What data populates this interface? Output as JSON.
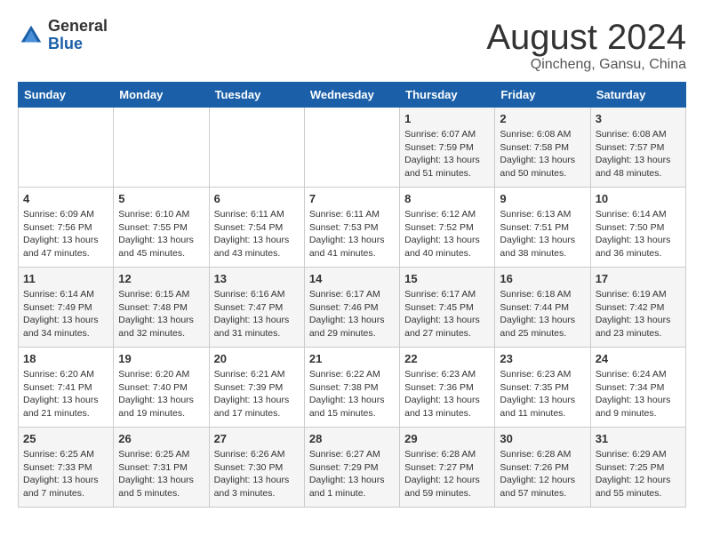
{
  "header": {
    "logo_general": "General",
    "logo_blue": "Blue",
    "month_title": "August 2024",
    "location": "Qincheng, Gansu, China"
  },
  "weekdays": [
    "Sunday",
    "Monday",
    "Tuesday",
    "Wednesday",
    "Thursday",
    "Friday",
    "Saturday"
  ],
  "weeks": [
    [
      {
        "day": "",
        "info": ""
      },
      {
        "day": "",
        "info": ""
      },
      {
        "day": "",
        "info": ""
      },
      {
        "day": "",
        "info": ""
      },
      {
        "day": "1",
        "info": "Sunrise: 6:07 AM\nSunset: 7:59 PM\nDaylight: 13 hours\nand 51 minutes."
      },
      {
        "day": "2",
        "info": "Sunrise: 6:08 AM\nSunset: 7:58 PM\nDaylight: 13 hours\nand 50 minutes."
      },
      {
        "day": "3",
        "info": "Sunrise: 6:08 AM\nSunset: 7:57 PM\nDaylight: 13 hours\nand 48 minutes."
      }
    ],
    [
      {
        "day": "4",
        "info": "Sunrise: 6:09 AM\nSunset: 7:56 PM\nDaylight: 13 hours\nand 47 minutes."
      },
      {
        "day": "5",
        "info": "Sunrise: 6:10 AM\nSunset: 7:55 PM\nDaylight: 13 hours\nand 45 minutes."
      },
      {
        "day": "6",
        "info": "Sunrise: 6:11 AM\nSunset: 7:54 PM\nDaylight: 13 hours\nand 43 minutes."
      },
      {
        "day": "7",
        "info": "Sunrise: 6:11 AM\nSunset: 7:53 PM\nDaylight: 13 hours\nand 41 minutes."
      },
      {
        "day": "8",
        "info": "Sunrise: 6:12 AM\nSunset: 7:52 PM\nDaylight: 13 hours\nand 40 minutes."
      },
      {
        "day": "9",
        "info": "Sunrise: 6:13 AM\nSunset: 7:51 PM\nDaylight: 13 hours\nand 38 minutes."
      },
      {
        "day": "10",
        "info": "Sunrise: 6:14 AM\nSunset: 7:50 PM\nDaylight: 13 hours\nand 36 minutes."
      }
    ],
    [
      {
        "day": "11",
        "info": "Sunrise: 6:14 AM\nSunset: 7:49 PM\nDaylight: 13 hours\nand 34 minutes."
      },
      {
        "day": "12",
        "info": "Sunrise: 6:15 AM\nSunset: 7:48 PM\nDaylight: 13 hours\nand 32 minutes."
      },
      {
        "day": "13",
        "info": "Sunrise: 6:16 AM\nSunset: 7:47 PM\nDaylight: 13 hours\nand 31 minutes."
      },
      {
        "day": "14",
        "info": "Sunrise: 6:17 AM\nSunset: 7:46 PM\nDaylight: 13 hours\nand 29 minutes."
      },
      {
        "day": "15",
        "info": "Sunrise: 6:17 AM\nSunset: 7:45 PM\nDaylight: 13 hours\nand 27 minutes."
      },
      {
        "day": "16",
        "info": "Sunrise: 6:18 AM\nSunset: 7:44 PM\nDaylight: 13 hours\nand 25 minutes."
      },
      {
        "day": "17",
        "info": "Sunrise: 6:19 AM\nSunset: 7:42 PM\nDaylight: 13 hours\nand 23 minutes."
      }
    ],
    [
      {
        "day": "18",
        "info": "Sunrise: 6:20 AM\nSunset: 7:41 PM\nDaylight: 13 hours\nand 21 minutes."
      },
      {
        "day": "19",
        "info": "Sunrise: 6:20 AM\nSunset: 7:40 PM\nDaylight: 13 hours\nand 19 minutes."
      },
      {
        "day": "20",
        "info": "Sunrise: 6:21 AM\nSunset: 7:39 PM\nDaylight: 13 hours\nand 17 minutes."
      },
      {
        "day": "21",
        "info": "Sunrise: 6:22 AM\nSunset: 7:38 PM\nDaylight: 13 hours\nand 15 minutes."
      },
      {
        "day": "22",
        "info": "Sunrise: 6:23 AM\nSunset: 7:36 PM\nDaylight: 13 hours\nand 13 minutes."
      },
      {
        "day": "23",
        "info": "Sunrise: 6:23 AM\nSunset: 7:35 PM\nDaylight: 13 hours\nand 11 minutes."
      },
      {
        "day": "24",
        "info": "Sunrise: 6:24 AM\nSunset: 7:34 PM\nDaylight: 13 hours\nand 9 minutes."
      }
    ],
    [
      {
        "day": "25",
        "info": "Sunrise: 6:25 AM\nSunset: 7:33 PM\nDaylight: 13 hours\nand 7 minutes."
      },
      {
        "day": "26",
        "info": "Sunrise: 6:25 AM\nSunset: 7:31 PM\nDaylight: 13 hours\nand 5 minutes."
      },
      {
        "day": "27",
        "info": "Sunrise: 6:26 AM\nSunset: 7:30 PM\nDaylight: 13 hours\nand 3 minutes."
      },
      {
        "day": "28",
        "info": "Sunrise: 6:27 AM\nSunset: 7:29 PM\nDaylight: 13 hours\nand 1 minute."
      },
      {
        "day": "29",
        "info": "Sunrise: 6:28 AM\nSunset: 7:27 PM\nDaylight: 12 hours\nand 59 minutes."
      },
      {
        "day": "30",
        "info": "Sunrise: 6:28 AM\nSunset: 7:26 PM\nDaylight: 12 hours\nand 57 minutes."
      },
      {
        "day": "31",
        "info": "Sunrise: 6:29 AM\nSunset: 7:25 PM\nDaylight: 12 hours\nand 55 minutes."
      }
    ]
  ]
}
